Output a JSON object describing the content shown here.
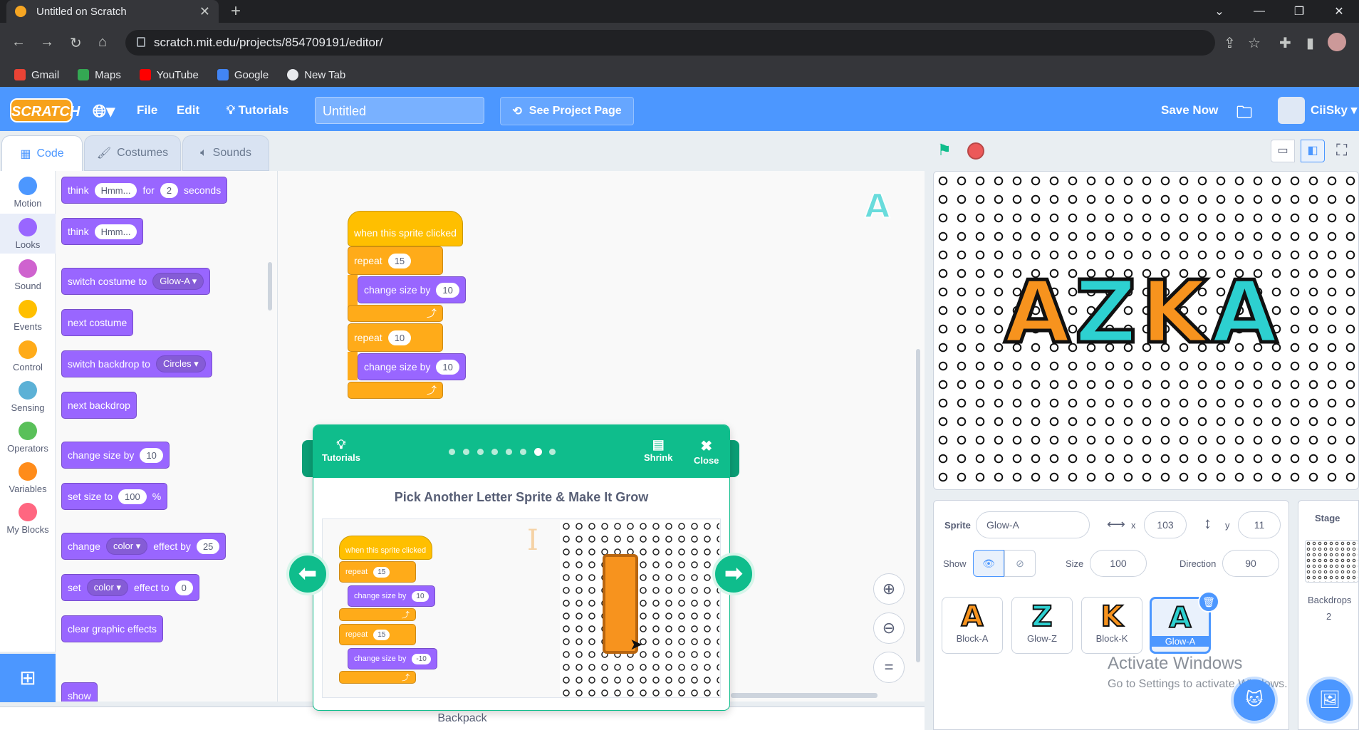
{
  "browser": {
    "tab_title": "Untitled on Scratch",
    "url": "scratch.mit.edu/projects/854709191/editor/",
    "bookmarks": [
      {
        "label": "Gmail",
        "color": "#ea4335"
      },
      {
        "label": "Maps",
        "color": "#34a853"
      },
      {
        "label": "YouTube",
        "color": "#ff0000"
      },
      {
        "label": "Google",
        "color": "#4285f4"
      },
      {
        "label": "New Tab",
        "color": "#e8eaed"
      }
    ]
  },
  "menubar": {
    "logo": "SCRATCH",
    "file": "File",
    "edit": "Edit",
    "tutorials": "Tutorials",
    "project_title": "Untitled",
    "see_project": "See Project Page",
    "save_now": "Save Now",
    "username": "CiiSky"
  },
  "tabs": {
    "code": "Code",
    "costumes": "Costumes",
    "sounds": "Sounds"
  },
  "categories": [
    {
      "label": "Motion",
      "color": "#4c97ff"
    },
    {
      "label": "Looks",
      "color": "#9966ff"
    },
    {
      "label": "Sound",
      "color": "#cf63cf"
    },
    {
      "label": "Events",
      "color": "#ffbf00"
    },
    {
      "label": "Control",
      "color": "#ffab19"
    },
    {
      "label": "Sensing",
      "color": "#5cb1d6"
    },
    {
      "label": "Operators",
      "color": "#59c059"
    },
    {
      "label": "Variables",
      "color": "#ff8c1a"
    },
    {
      "label": "My Blocks",
      "color": "#ff6680"
    }
  ],
  "palette": {
    "think_for": {
      "t1": "think",
      "v1": "Hmm...",
      "t2": "for",
      "v2": "2",
      "t3": "seconds"
    },
    "think": {
      "t1": "think",
      "v1": "Hmm..."
    },
    "switch_costume": {
      "t1": "switch costume to",
      "v1": "Glow-A"
    },
    "next_costume": "next costume",
    "switch_backdrop": {
      "t1": "switch backdrop to",
      "v1": "Circles"
    },
    "next_backdrop": "next backdrop",
    "change_size": {
      "t1": "change size by",
      "v1": "10"
    },
    "set_size": {
      "t1": "set size to",
      "v1": "100",
      "t2": "%"
    },
    "change_effect": {
      "t1": "change",
      "v1": "color",
      "t2": "effect by",
      "v2": "25"
    },
    "set_effect": {
      "t1": "set",
      "v1": "color",
      "t2": "effect to",
      "v2": "0"
    },
    "clear": "clear graphic effects",
    "show": "show"
  },
  "script": {
    "hat": "when this sprite clicked",
    "repeat1": {
      "label": "repeat",
      "count": "15"
    },
    "change1": {
      "label": "change size by",
      "value": "10"
    },
    "repeat2": {
      "label": "repeat",
      "count": "10"
    },
    "change2": {
      "label": "change size by",
      "value": "10"
    }
  },
  "tutorial": {
    "tutorials": "Tutorials",
    "shrink": "Shrink",
    "close": "Close",
    "title": "Pick Another Letter Sprite & Make It Grow",
    "img": {
      "hat": "when this sprite clicked",
      "repeat1": "repeat",
      "r1c": "15",
      "change1": "change size by",
      "c1v": "10",
      "repeat2": "repeat",
      "r2c": "15",
      "change2": "change size by",
      "c2v": "-10"
    }
  },
  "backpack": "Backpack",
  "stage_letters": [
    {
      "ch": "A",
      "color": "#f7931e"
    },
    {
      "ch": "Z",
      "color": "#2dd0d0"
    },
    {
      "ch": "K",
      "color": "#f7931e"
    },
    {
      "ch": "A",
      "color": "#2dd0d0"
    }
  ],
  "sprite_info": {
    "sprite_label": "Sprite",
    "sprite_name": "Glow-A",
    "x_label": "x",
    "x": "103",
    "y_label": "y",
    "y": "11",
    "show_label": "Show",
    "size_label": "Size",
    "size": "100",
    "direction_label": "Direction",
    "direction": "90"
  },
  "sprites": [
    {
      "name": "Block-A",
      "ch": "A",
      "color": "#f7931e"
    },
    {
      "name": "Glow-Z",
      "ch": "Z",
      "color": "#2dd0d0"
    },
    {
      "name": "Block-K",
      "ch": "K",
      "color": "#f7931e"
    },
    {
      "name": "Glow-A",
      "ch": "A",
      "color": "#2dd0d0"
    }
  ],
  "stage_pane": {
    "title": "Stage",
    "backdrops_label": "Backdrops",
    "backdrops_count": "2"
  },
  "watermark": {
    "line1": "Activate Windows",
    "line2": "Go to Settings to activate Windows."
  }
}
